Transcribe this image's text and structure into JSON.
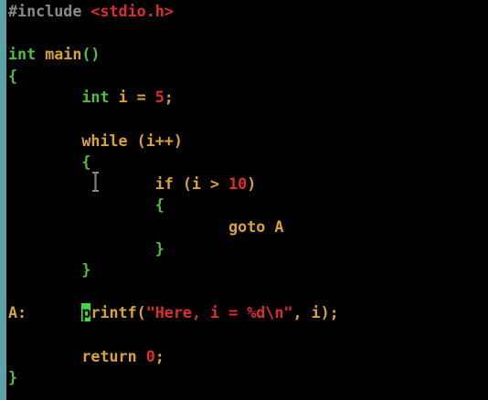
{
  "editor": {
    "lines": [
      [
        {
          "t": "#include ",
          "c": "pre"
        },
        {
          "t": "<stdio.h>",
          "c": "str"
        }
      ],
      [],
      [
        {
          "t": "int ",
          "c": "type"
        },
        {
          "t": "main",
          "c": "fn"
        },
        {
          "t": "()",
          "c": "punc"
        }
      ],
      [
        {
          "t": "{",
          "c": "punc"
        }
      ],
      [
        {
          "t": "        ",
          "c": "id"
        },
        {
          "t": "int ",
          "c": "type"
        },
        {
          "t": "i ",
          "c": "id"
        },
        {
          "t": "= ",
          "c": "id"
        },
        {
          "t": "5",
          "c": "num"
        },
        {
          "t": ";",
          "c": "id"
        }
      ],
      [],
      [
        {
          "t": "        ",
          "c": "id"
        },
        {
          "t": "while ",
          "c": "kw"
        },
        {
          "t": "(i++)",
          "c": "id"
        }
      ],
      [
        {
          "t": "        ",
          "c": "id"
        },
        {
          "t": "{",
          "c": "punc"
        }
      ],
      [
        {
          "t": "                ",
          "c": "id"
        },
        {
          "t": "if ",
          "c": "kw"
        },
        {
          "t": "(i > ",
          "c": "id"
        },
        {
          "t": "10",
          "c": "num"
        },
        {
          "t": ")",
          "c": "id"
        }
      ],
      [
        {
          "t": "                ",
          "c": "id"
        },
        {
          "t": "{",
          "c": "punc"
        }
      ],
      [
        {
          "t": "                        ",
          "c": "id"
        },
        {
          "t": "goto ",
          "c": "kw"
        },
        {
          "t": "A",
          "c": "id"
        }
      ],
      [
        {
          "t": "                ",
          "c": "id"
        },
        {
          "t": "}",
          "c": "punc"
        }
      ],
      [
        {
          "t": "        ",
          "c": "id"
        },
        {
          "t": "}",
          "c": "punc"
        }
      ],
      [],
      [
        {
          "t": "A:",
          "c": "label"
        },
        {
          "t": "      ",
          "c": "id"
        },
        {
          "t": "p",
          "c": "cursor"
        },
        {
          "t": "rintf",
          "c": "fn"
        },
        {
          "t": "(",
          "c": "id"
        },
        {
          "t": "\"Here, i = %d\\n\"",
          "c": "str"
        },
        {
          "t": ", i);",
          "c": "id"
        }
      ],
      [],
      [
        {
          "t": "        ",
          "c": "id"
        },
        {
          "t": "return ",
          "c": "kw"
        },
        {
          "t": "0",
          "c": "num"
        },
        {
          "t": ";",
          "c": "id"
        }
      ],
      [
        {
          "t": "}",
          "c": "punc"
        }
      ]
    ]
  },
  "colors": {
    "background": "#000000",
    "left_border": "#5aa3a8",
    "preprocessor": "#8a8a8a",
    "string": "#dd2d2d",
    "type": "#4fbf3c",
    "keyword": "#d7a339",
    "number": "#dd2d2d",
    "cursor": "#3ddc3d"
  },
  "mouse_pointer": "text-cursor-ibeam-icon"
}
